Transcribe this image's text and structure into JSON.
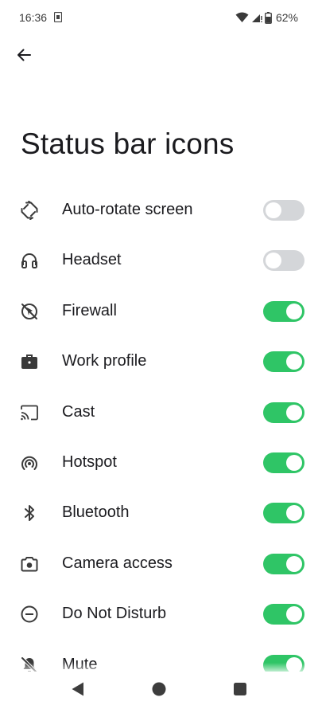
{
  "status_bar": {
    "time": "16:36",
    "battery": "62%"
  },
  "title": "Status bar icons",
  "settings": [
    {
      "label": "Auto-rotate screen",
      "icon": "auto-rotate-icon",
      "enabled": false
    },
    {
      "label": "Headset",
      "icon": "headset-icon",
      "enabled": false
    },
    {
      "label": "Firewall",
      "icon": "firewall-icon",
      "enabled": true
    },
    {
      "label": "Work profile",
      "icon": "briefcase-icon",
      "enabled": true
    },
    {
      "label": "Cast",
      "icon": "cast-icon",
      "enabled": true
    },
    {
      "label": "Hotspot",
      "icon": "hotspot-icon",
      "enabled": true
    },
    {
      "label": "Bluetooth",
      "icon": "bluetooth-icon",
      "enabled": true
    },
    {
      "label": "Camera access",
      "icon": "camera-icon",
      "enabled": true
    },
    {
      "label": "Do Not Disturb",
      "icon": "do-not-disturb-icon",
      "enabled": true
    },
    {
      "label": "Mute",
      "icon": "mute-icon",
      "enabled": true
    }
  ],
  "colors": {
    "toggle_on": "#2fc566",
    "toggle_off": "#d4d6d9"
  }
}
